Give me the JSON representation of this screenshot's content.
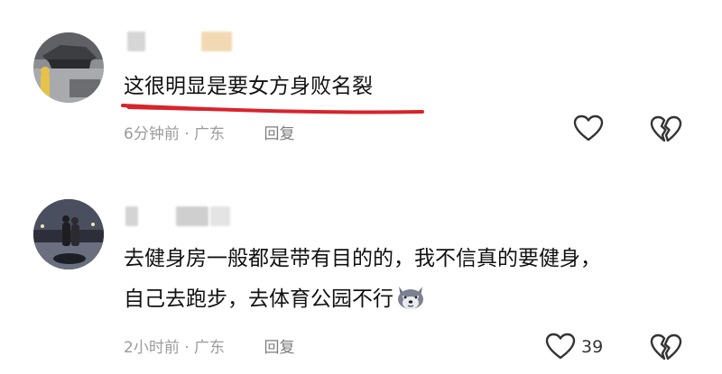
{
  "comments": [
    {
      "name_visible": "",
      "text_lines": [
        "这很明显是要女方身败名裂"
      ],
      "time": "6分钟前",
      "separator": "·",
      "location": "广东",
      "reply_label": "回复",
      "like_count": ""
    },
    {
      "name_visible": "",
      "text_lines": [
        "去健身房一般都是带有目的的，我不信真的要健身，",
        "自己去跑步，去体育公园不行"
      ],
      "time": "2小时前",
      "separator": "·",
      "location": "广东",
      "reply_label": "回复",
      "like_count": "39"
    }
  ],
  "icons": {
    "like": "heart-outline-icon",
    "dislike": "broken-heart-icon",
    "emoji": "wolf-face-emoji"
  },
  "colors": {
    "text": "#111111",
    "meta": "#9b9b9b",
    "underline": "#d9232b",
    "icon_stroke": "#333333"
  }
}
